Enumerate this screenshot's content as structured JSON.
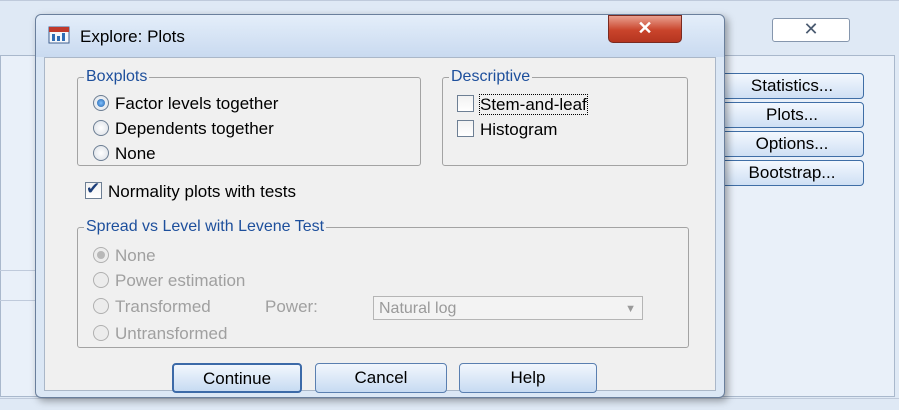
{
  "parent": {
    "close_glyph": "✕",
    "buttons": [
      "Statistics...",
      "Plots...",
      "Options...",
      "Bootstrap..."
    ]
  },
  "dialog": {
    "title": "Explore: Plots",
    "close_glyph": "✕",
    "boxplots": {
      "legend": "Boxplots",
      "options": [
        {
          "label": "Factor levels together",
          "selected": true
        },
        {
          "label": "Dependents together",
          "selected": false
        },
        {
          "label": "None",
          "selected": false
        }
      ]
    },
    "descriptive": {
      "legend": "Descriptive",
      "options": [
        {
          "label": "Stem-and-leaf",
          "checked": false
        },
        {
          "label": "Histogram",
          "checked": false
        }
      ]
    },
    "normality": {
      "label": "Normality plots with tests",
      "checked": true
    },
    "spread": {
      "legend": "Spread vs Level with Levene Test",
      "options": [
        {
          "label": "None",
          "selected": true
        },
        {
          "label": "Power estimation",
          "selected": false
        },
        {
          "label": "Transformed",
          "selected": false
        },
        {
          "label": "Untransformed",
          "selected": false
        }
      ],
      "power_label": "Power:",
      "power_value": "Natural log"
    },
    "buttons": {
      "continue": "Continue",
      "cancel": "Cancel",
      "help": "Help"
    }
  }
}
